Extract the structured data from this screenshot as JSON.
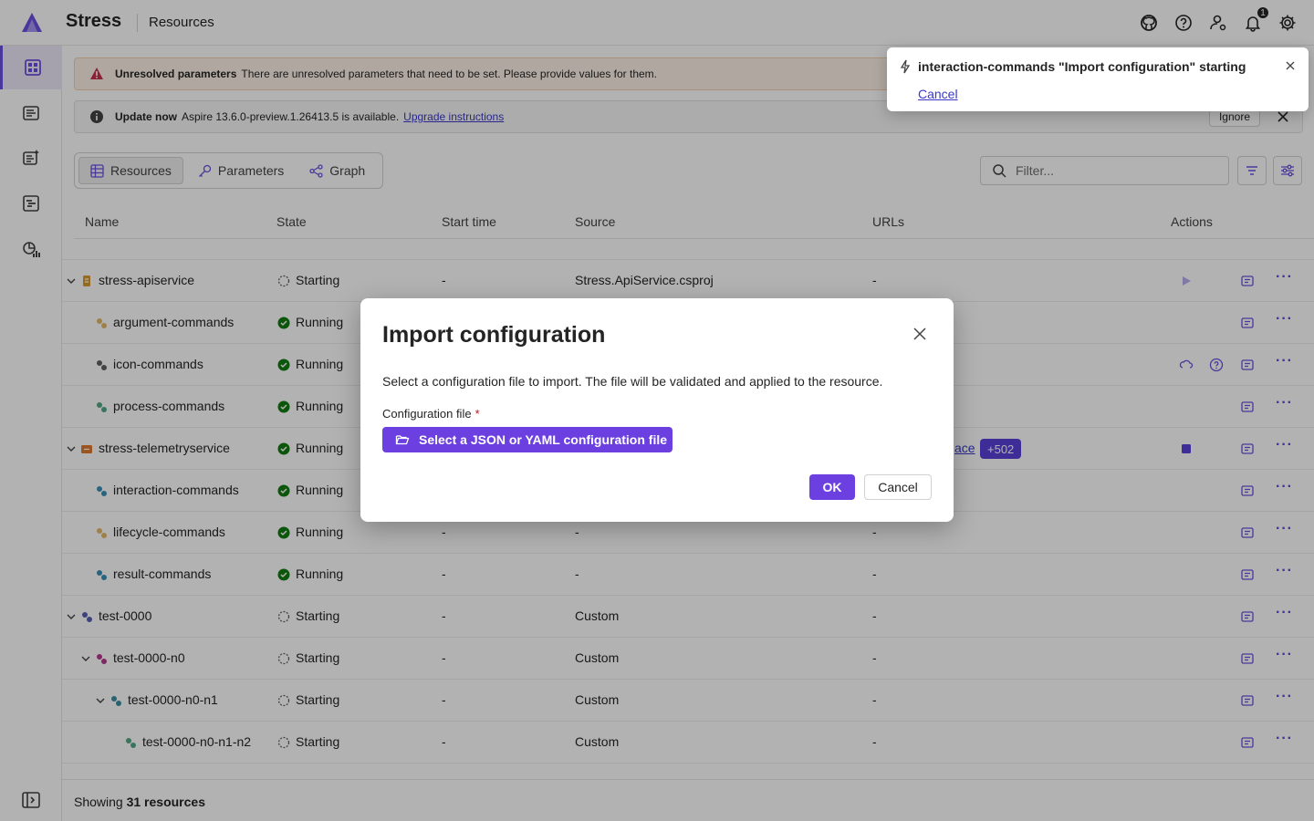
{
  "app": {
    "title": "Stress",
    "page": "Resources"
  },
  "header": {
    "notification_count": "1"
  },
  "banners": {
    "warning": {
      "title": "Unresolved parameters",
      "text": "There are unresolved parameters that need to be set. Please provide values for them."
    },
    "update": {
      "title": "Update now",
      "text": "Aspire 13.6.0-preview.1.26413.5 is available.",
      "link": "Upgrade instructions",
      "ignore": "Ignore"
    }
  },
  "tabs": [
    {
      "label": "Resources"
    },
    {
      "label": "Parameters"
    },
    {
      "label": "Graph"
    }
  ],
  "filter": {
    "placeholder": "Filter..."
  },
  "columns": {
    "name": "Name",
    "state": "State",
    "start_time": "Start time",
    "source": "Source",
    "urls": "URLs",
    "actions": "Actions"
  },
  "rows": [
    {
      "name": "stress-apiservice",
      "state": "Starting",
      "start": "-",
      "source": "Stress.ApiService.csproj",
      "urls": "-"
    },
    {
      "name": "argument-commands",
      "state": "Running",
      "start": "",
      "source": "",
      "urls": ""
    },
    {
      "name": "icon-commands",
      "state": "Running",
      "start": "",
      "source": "",
      "urls": ""
    },
    {
      "name": "process-commands",
      "state": "Running",
      "start": "",
      "source": "",
      "urls": ""
    },
    {
      "name": "stress-telemetryservice",
      "state": "Running",
      "start": "",
      "source": "",
      "urls": "ace",
      "chip": "+502"
    },
    {
      "name": "interaction-commands",
      "state": "Running",
      "start": "",
      "source": "",
      "urls": ""
    },
    {
      "name": "lifecycle-commands",
      "state": "Running",
      "start": "-",
      "source": "-",
      "urls": "-"
    },
    {
      "name": "result-commands",
      "state": "Running",
      "start": "-",
      "source": "-",
      "urls": "-"
    },
    {
      "name": "test-0000",
      "state": "Starting",
      "start": "-",
      "source": "Custom",
      "urls": "-"
    },
    {
      "name": "test-0000-n0",
      "state": "Starting",
      "start": "-",
      "source": "Custom",
      "urls": "-"
    },
    {
      "name": "test-0000-n0-n1",
      "state": "Starting",
      "start": "-",
      "source": "Custom",
      "urls": "-"
    },
    {
      "name": "test-0000-n0-n1-n2",
      "state": "Starting",
      "start": "-",
      "source": "Custom",
      "urls": "-"
    }
  ],
  "footer": {
    "prefix": "Showing",
    "count": "31 resources"
  },
  "dialog": {
    "title": "Import configuration",
    "description": "Select a configuration file to import. The file will be validated and applied to the resource.",
    "field_label": "Configuration file",
    "required_mark": "*",
    "file_button": "Select a JSON or YAML configuration file",
    "ok": "OK",
    "cancel": "Cancel"
  },
  "toast": {
    "title": "interaction-commands \"Import configuration\" starting",
    "cancel": "Cancel"
  },
  "colors": {
    "accent": "#6b3fe0",
    "running": "#107c10",
    "warning": "#c4314b"
  }
}
